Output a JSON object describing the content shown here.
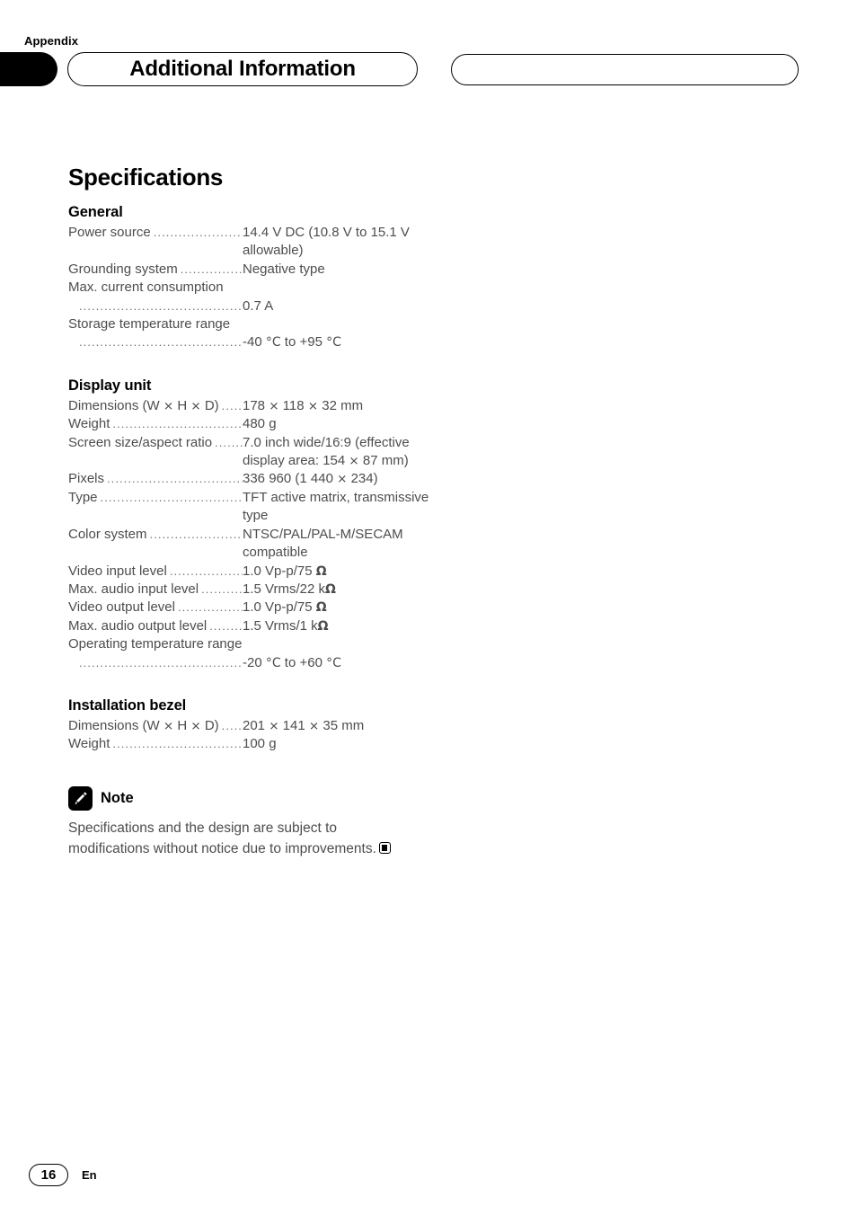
{
  "header": {
    "appendix_label": "Appendix",
    "title": "Additional Information",
    "right_pill_text": ""
  },
  "page": {
    "title": "Specifications"
  },
  "sections": [
    {
      "heading": "General",
      "rows": [
        {
          "type": "pair",
          "label": "Power source",
          "value": "14.4 V DC (10.8 V to 15.1 V allowable)"
        },
        {
          "type": "pair",
          "label": "Grounding system",
          "value": "Negative type"
        },
        {
          "type": "labelonly",
          "label": "Max. current consumption",
          "value": ""
        },
        {
          "type": "cont",
          "label": "",
          "value": "0.7 A"
        },
        {
          "type": "labelonly",
          "label": "Storage temperature range",
          "value": ""
        },
        {
          "type": "cont",
          "label": "",
          "value": "-40 °C to +95 °C"
        }
      ]
    },
    {
      "heading": "Display unit",
      "rows": [
        {
          "type": "pair",
          "label": "Dimensions (W × H × D)",
          "value": "178 × 118 × 32 mm"
        },
        {
          "type": "pair",
          "label": "Weight",
          "value": "480 g"
        },
        {
          "type": "pair",
          "label": "Screen size/aspect ratio",
          "value": "7.0 inch wide/16:9 (effective display area: 154 × 87 mm)"
        },
        {
          "type": "pair",
          "label": "Pixels",
          "value": "336 960 (1 440 × 234)"
        },
        {
          "type": "pair",
          "label": "Type",
          "value": "TFT active matrix, transmissive type"
        },
        {
          "type": "pair",
          "label": "Color system",
          "value": "NTSC/PAL/PAL-M/SECAM compatible"
        },
        {
          "type": "pair",
          "label": "Video input level",
          "value": "1.0 Vp-p/75 Ω"
        },
        {
          "type": "pair",
          "label": "Max. audio input level",
          "value": "1.5 Vrms/22 kΩ"
        },
        {
          "type": "pair",
          "label": "Video output level",
          "value": "1.0 Vp-p/75 Ω"
        },
        {
          "type": "pair",
          "label": "Max. audio output level",
          "value": "1.5 Vrms/1 kΩ"
        },
        {
          "type": "labelonly",
          "label": "Operating temperature range",
          "value": ""
        },
        {
          "type": "cont",
          "label": "",
          "value": "-20 °C to +60 °C"
        }
      ]
    },
    {
      "heading": "Installation bezel",
      "rows": [
        {
          "type": "pair",
          "label": "Dimensions (W × H × D)",
          "value": "201 × 141 × 35 mm"
        },
        {
          "type": "pair",
          "label": "Weight",
          "value": "100 g"
        }
      ]
    }
  ],
  "note": {
    "icon": "pencil-icon",
    "title": "Note",
    "body": "Specifications and the design are subject to modifications without notice due to improvements."
  },
  "footer": {
    "page_number": "16",
    "language_code": "En"
  },
  "colors": {
    "body_text": "#4d4d4d",
    "heading_text": "#000000",
    "accent": "#000000",
    "background": "#ffffff"
  }
}
